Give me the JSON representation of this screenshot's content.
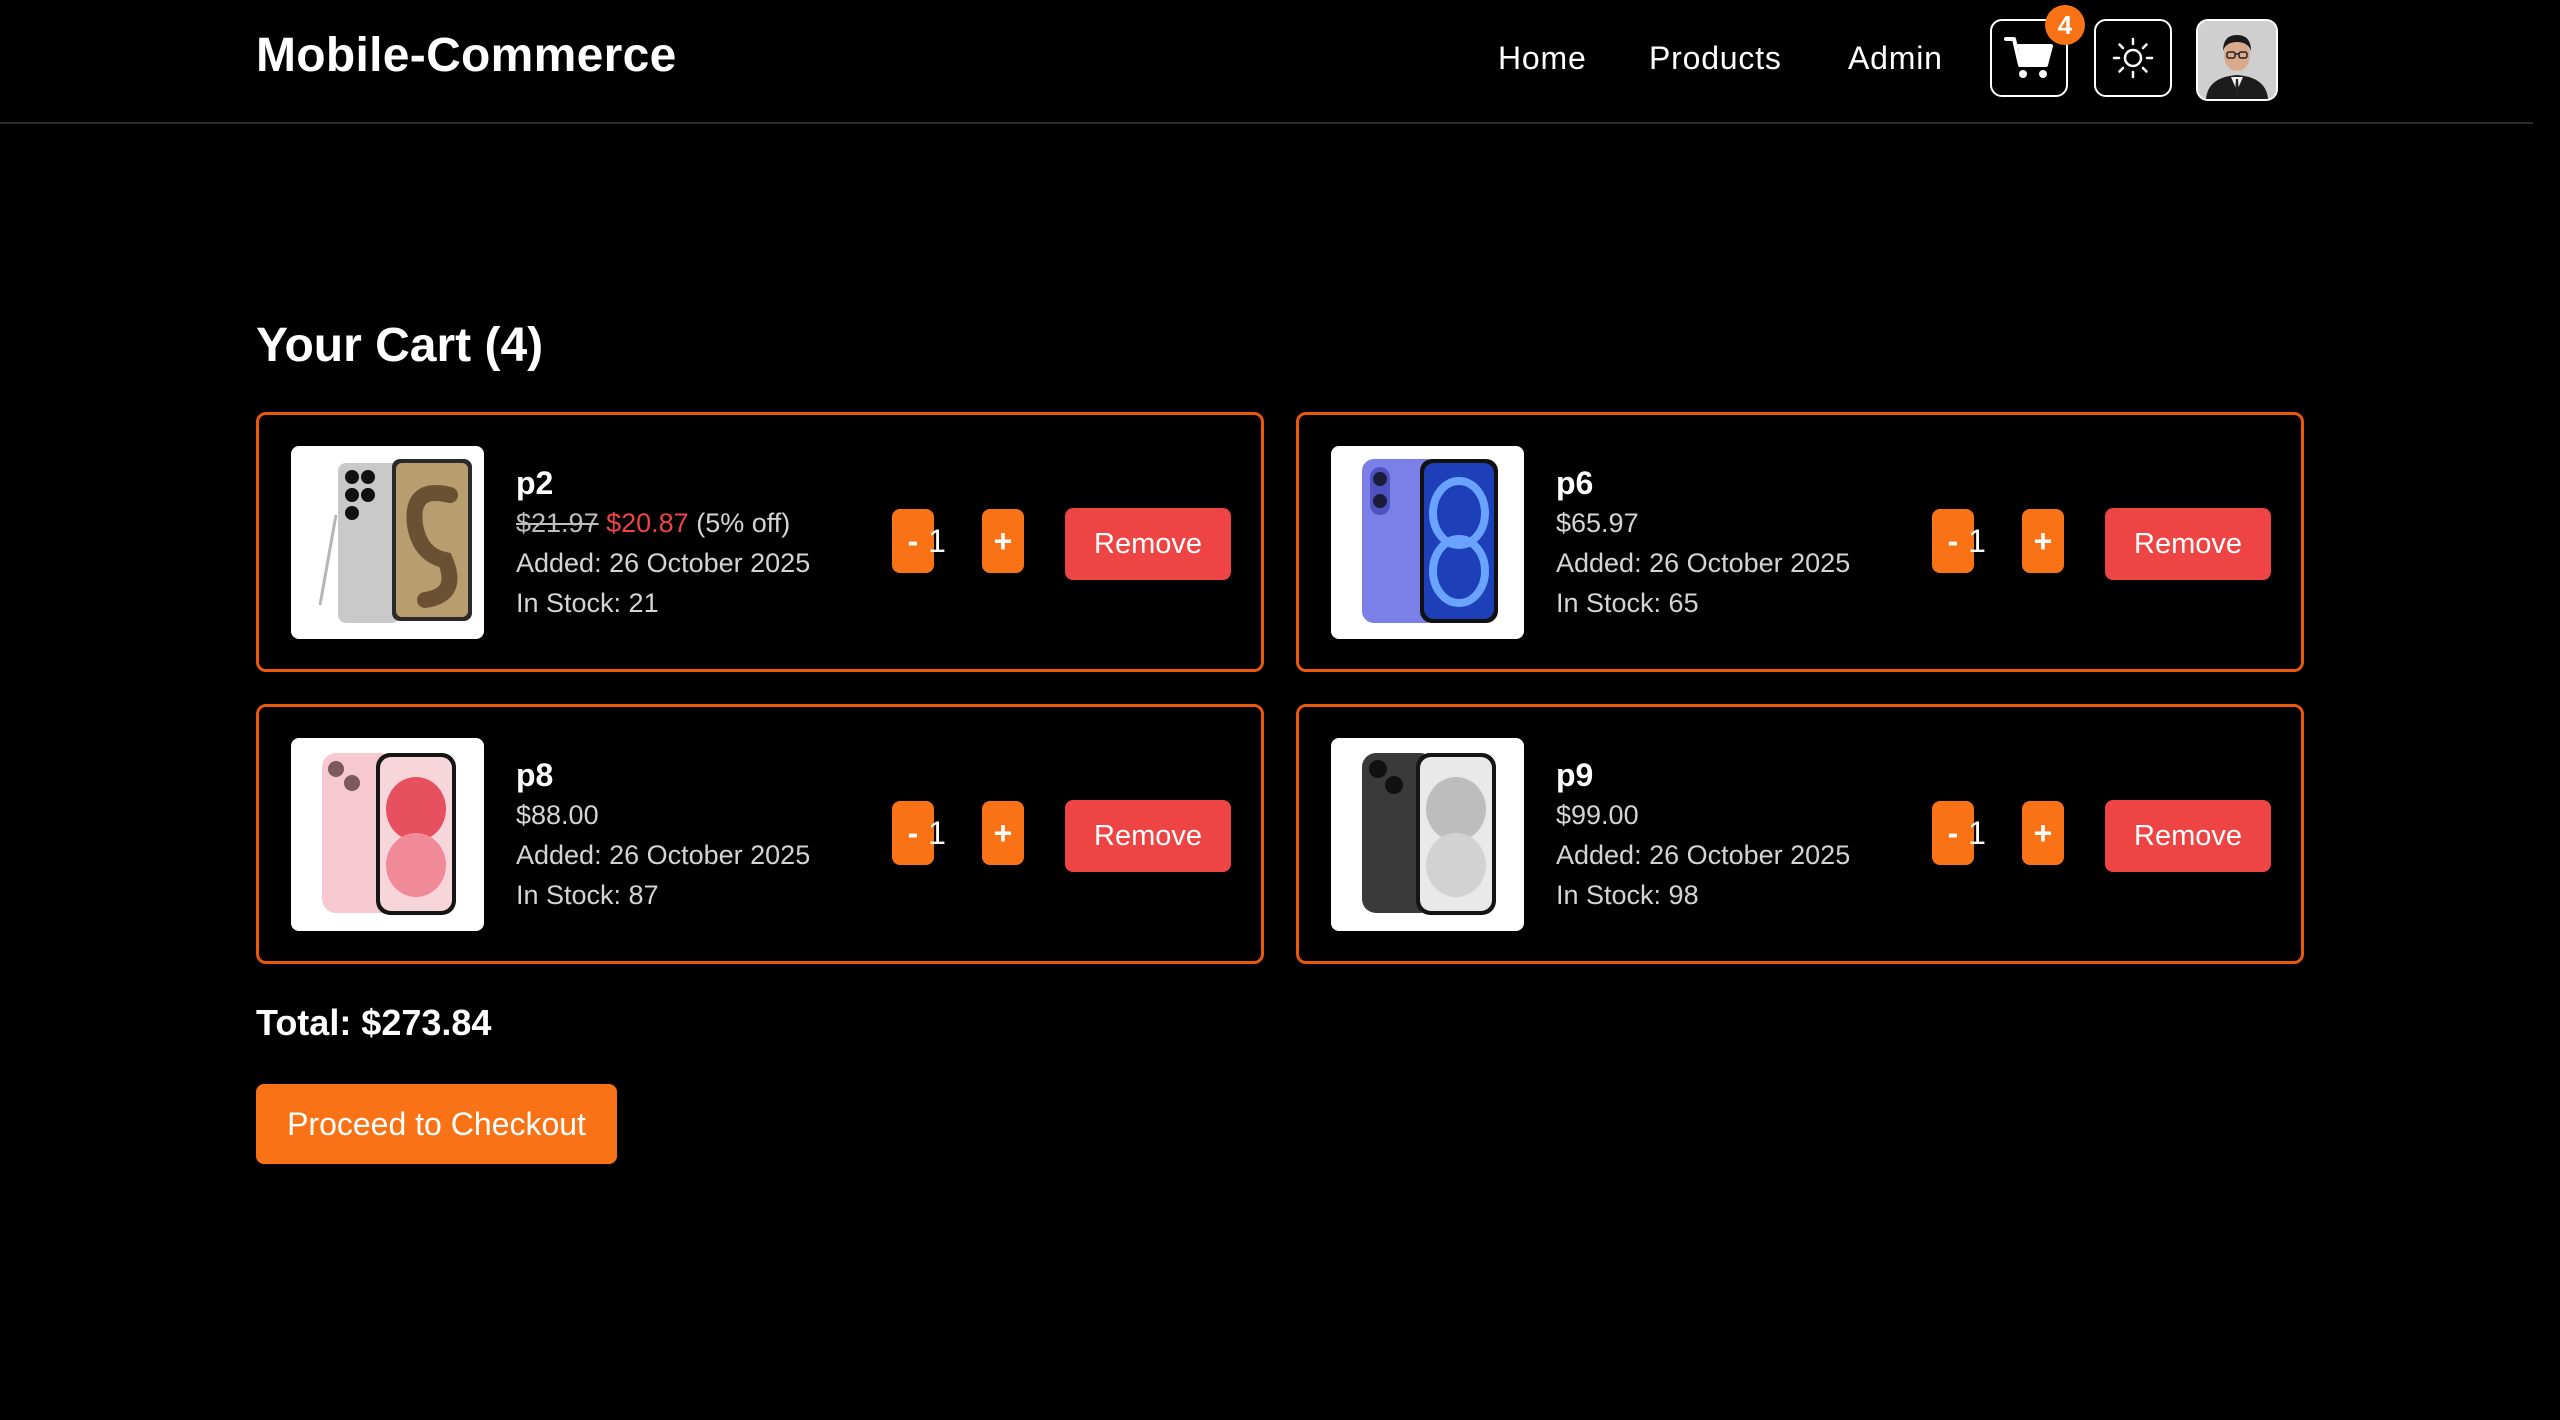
{
  "header": {
    "brand": "Mobile-Commerce",
    "nav": [
      "Home",
      "Products",
      "Admin"
    ],
    "cart_icon": "cart-icon",
    "cart_count": "4",
    "theme_icon": "sun-icon",
    "avatar_icon": "avatar"
  },
  "cart": {
    "title": "Your Cart (4)",
    "items": [
      {
        "name": "p2",
        "old_price": "$21.97",
        "sale_price": "$20.87",
        "discount": "(5% off)",
        "added": "Added: 26 October 2025",
        "stock": "In Stock: 21",
        "qty": "1",
        "minus": "-",
        "plus": "+",
        "remove": "Remove"
      },
      {
        "name": "p6",
        "price": "$65.97",
        "added": "Added: 26 October 2025",
        "stock": "In Stock: 65",
        "qty": "1",
        "minus": "-",
        "plus": "+",
        "remove": "Remove"
      },
      {
        "name": "p8",
        "price": "$88.00",
        "added": "Added: 26 October 2025",
        "stock": "In Stock: 87",
        "qty": "1",
        "minus": "-",
        "plus": "+",
        "remove": "Remove"
      },
      {
        "name": "p9",
        "price": "$99.00",
        "added": "Added: 26 October 2025",
        "stock": "In Stock: 98",
        "qty": "1",
        "minus": "-",
        "plus": "+",
        "remove": "Remove"
      }
    ],
    "total": "Total: $273.84",
    "checkout": "Proceed to Checkout"
  },
  "colors": {
    "accent": "#f97316",
    "card_border": "#ea580c",
    "danger": "#ef4444",
    "background": "#000000"
  }
}
